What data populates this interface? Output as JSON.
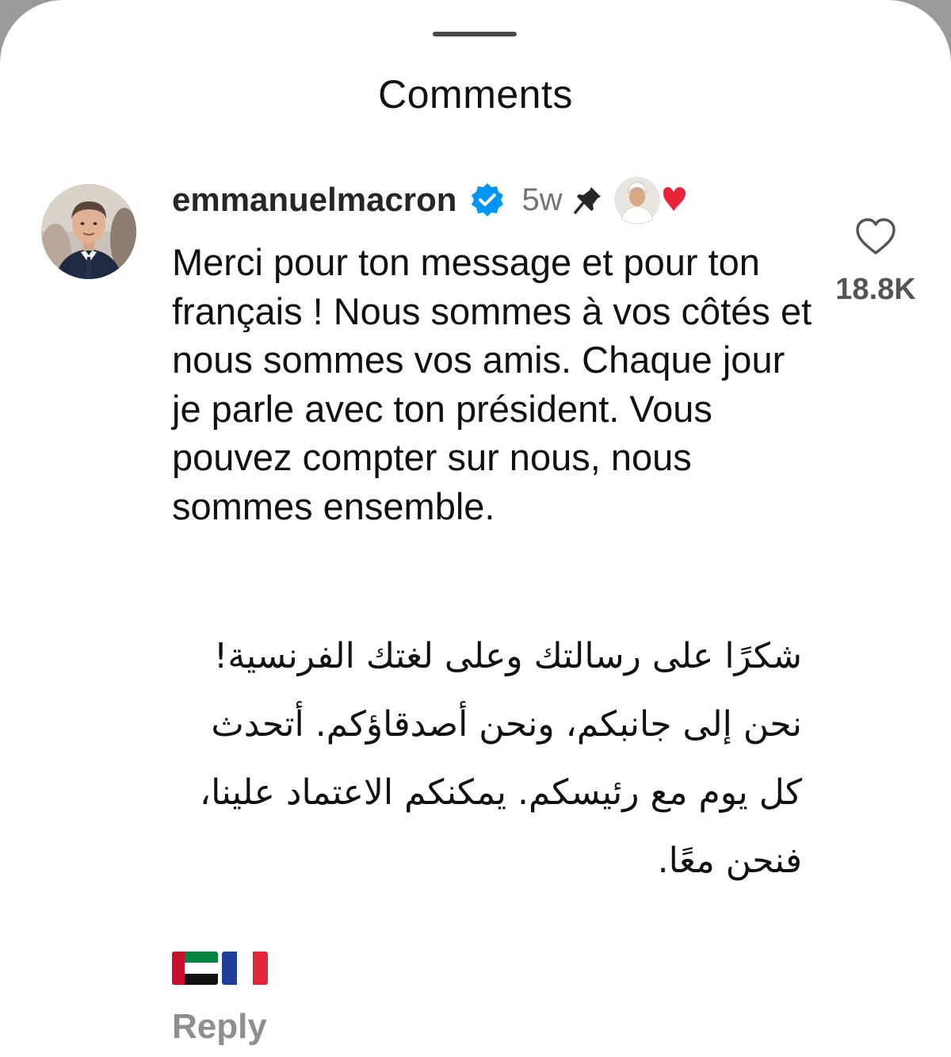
{
  "sheet": {
    "title": "Comments"
  },
  "comment": {
    "username": "emmanuelmacron",
    "verified_icon": "verified-badge-icon",
    "timestamp": "5w",
    "pinned_icon": "pin-icon",
    "liked_by_creator_icon": "creator-heart-avatar-icon",
    "text_fr": "Merci pour ton message et pour ton français ! Nous sommes à vos côtés et nous sommes vos amis. Chaque jour je parle avec ton président. Vous pouvez compter sur nous, nous sommes ensemble.",
    "text_ar_lines": [
      "شكرًا على رسالتك وعلى لغتك الفرنسية!",
      "نحن إلى جانبكم، ونحن أصدقاؤكم. أتحدث",
      "كل يوم مع رئيسكم. يمكنكم الاعتماد علينا،",
      "فنحن معًا."
    ],
    "flags": [
      "🇦🇪",
      "🇫🇷"
    ],
    "reply_label": "Reply",
    "like_icon": "heart-outline-icon",
    "like_count": "18.8K"
  },
  "colors": {
    "verified_blue": "#0095f6",
    "heart_red": "#e8243c",
    "secondary_text": "#8e8e8e"
  }
}
